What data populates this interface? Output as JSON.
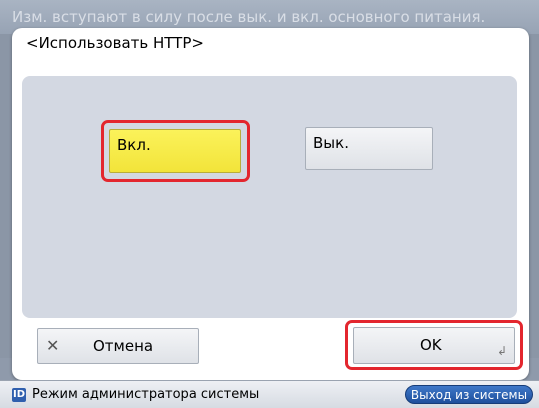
{
  "background": {
    "banner_text": "Изм. вступают в силу после вык. и вкл. основного питания."
  },
  "dialog": {
    "title": "<Использовать HTTP>",
    "options": {
      "on_label": "Вкл.",
      "off_label": "Вык.",
      "selected": "on"
    },
    "cancel_label": "Отмена",
    "ok_label": "OK"
  },
  "status_bar": {
    "id_label": "ID",
    "mode_text": "Режим администратора системы",
    "logout_label": "Выход из системы"
  },
  "colors": {
    "selected_option": "#f6ea45",
    "highlight": "#e3262e",
    "panel": "#d3d8e2",
    "logout_button": "#2a61b4"
  }
}
